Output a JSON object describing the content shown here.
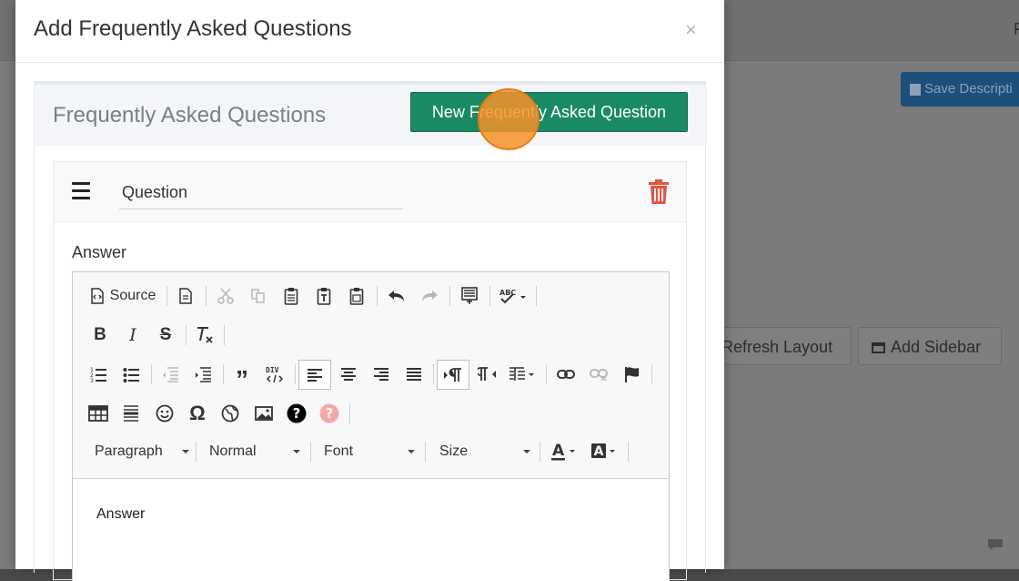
{
  "background": {
    "save_button_label": "Save Descripti",
    "refresh_layout_label": "Refresh Layout",
    "add_sidebar_label": "Add Sidebar",
    "fragment_r": "F"
  },
  "modal": {
    "title": "Add Frequently Asked Questions",
    "close_glyph": "×"
  },
  "panel": {
    "title": "Frequently Asked Questions",
    "new_button_label": "New Frequently Asked Question"
  },
  "faq_item": {
    "question_value": "Question",
    "answer_label": "Answer"
  },
  "editor": {
    "source_label": "Source",
    "format_combo": "Paragraph",
    "style_combo": "Normal",
    "font_combo": "Font",
    "size_combo": "Size",
    "content": "Answer",
    "colors": {
      "help_disabled": "#f4a9a9",
      "trash": "#e5533f",
      "accent_green": "#1a8a63"
    }
  }
}
